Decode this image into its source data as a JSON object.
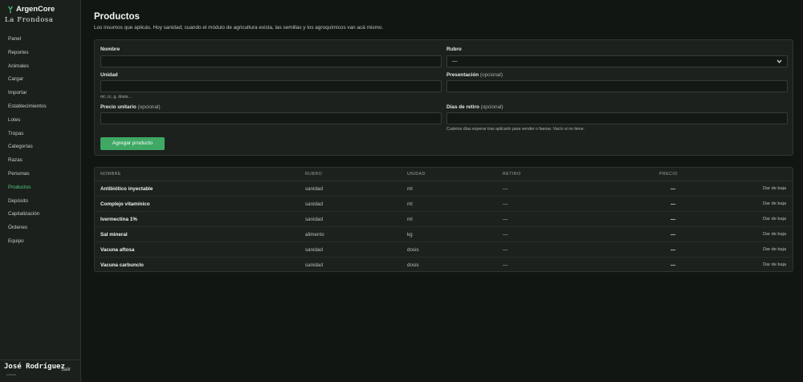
{
  "brand": {
    "name": "ArgenCore",
    "org": "La Frondosa"
  },
  "nav": [
    {
      "label": "Panel",
      "active": false
    },
    {
      "label": "Reportes",
      "active": false
    },
    {
      "label": "Animales",
      "active": false
    },
    {
      "label": "Cargar",
      "active": false
    },
    {
      "label": "Importar",
      "active": false
    },
    {
      "label": "Establecimientos",
      "active": false
    },
    {
      "label": "Lotes",
      "active": false
    },
    {
      "label": "Tropas",
      "active": false
    },
    {
      "label": "Categorías",
      "active": false
    },
    {
      "label": "Razas",
      "active": false
    },
    {
      "label": "Personas",
      "active": false
    },
    {
      "label": "Productos",
      "active": true
    },
    {
      "label": "Depósito",
      "active": false
    },
    {
      "label": "Capitalización",
      "active": false
    },
    {
      "label": "Órdenes",
      "active": false
    },
    {
      "label": "Equipo",
      "active": false
    }
  ],
  "user": {
    "name": "José Rodríguez",
    "logout": "Salir"
  },
  "page": {
    "title": "Productos",
    "description": "Los insumos que aplicás. Hoy sanidad; cuando el módulo de agricultura exista, las semillas y los agroquímicos van acá mismo."
  },
  "form": {
    "nombre": {
      "label": "Nombre",
      "value": ""
    },
    "rubro": {
      "label": "Rubro",
      "value": "—"
    },
    "unidad": {
      "label": "Unidad",
      "value": "",
      "hint": "ml, cc, g, dosis…"
    },
    "presentacion": {
      "label": "Presentación",
      "optional": "(opcional)",
      "value": ""
    },
    "precio": {
      "label": "Precio unitario",
      "optional": "(opcional)",
      "value": ""
    },
    "retiro": {
      "label": "Días de retiro",
      "optional": "(opcional)",
      "value": "",
      "hint": "Cuántos días esperar tras aplicarlo para vender o faenar. Vacío si no tiene."
    },
    "submit": "Agregar producto"
  },
  "table": {
    "headers": {
      "nombre": "Nombre",
      "rubro": "Rubro",
      "unidad": "Unidad",
      "retiro": "Retiro",
      "precio": "Precio"
    },
    "rows": [
      {
        "nombre": "Antibiótico inyectable",
        "rubro": "sanidad",
        "unidad": "ml",
        "retiro": "—",
        "precio": "—",
        "action": "Dar de baja"
      },
      {
        "nombre": "Complejo vitamínico",
        "rubro": "sanidad",
        "unidad": "ml",
        "retiro": "—",
        "precio": "—",
        "action": "Dar de baja"
      },
      {
        "nombre": "Ivermectina 1%",
        "rubro": "sanidad",
        "unidad": "ml",
        "retiro": "—",
        "precio": "—",
        "action": "Dar de baja"
      },
      {
        "nombre": "Sal mineral",
        "rubro": "alimento",
        "unidad": "kg",
        "retiro": "—",
        "precio": "—",
        "action": "Dar de baja"
      },
      {
        "nombre": "Vacuna aftosa",
        "rubro": "sanidad",
        "unidad": "dosis",
        "retiro": "—",
        "precio": "—",
        "action": "Dar de baja"
      },
      {
        "nombre": "Vacuna carbunclo",
        "rubro": "sanidad",
        "unidad": "dosis",
        "retiro": "—",
        "precio": "—",
        "action": "Dar de baja"
      }
    ]
  },
  "colors": {
    "accent": "#4fc97a",
    "button": "#3ea864",
    "background": "#121613",
    "sidebar": "#1b201c"
  }
}
